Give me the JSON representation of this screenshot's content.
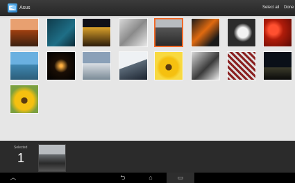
{
  "action_bar": {
    "title": "Asus",
    "select_all": "Select all",
    "done": "Done"
  },
  "gallery": {
    "rows": [
      [
        {
          "name": "tile-dusk-lamp",
          "bg": "linear-gradient(180deg,#e8a070 0 40%, #a04010 41%, #3a2010 100%)"
        },
        {
          "name": "tile-dark-teal",
          "bg": "linear-gradient(135deg,#0f3b4b,#1e6e86 60%, #0c2a36)"
        },
        {
          "name": "tile-night-city",
          "bg": "linear-gradient(180deg,#101018 0 30%, #d9a02a 31%, #2a1a0a 100%)"
        },
        {
          "name": "tile-cat",
          "bg": "linear-gradient(135deg,#d8d8d8,#8a8a8a 50%, #eaeaea)"
        },
        {
          "name": "tile-couple-walk",
          "bg": "linear-gradient(180deg,#b8bcc0 0 30%, #555 31%, #2a2a2a 100%)",
          "selected": true
        },
        {
          "name": "tile-clownfish",
          "bg": "linear-gradient(135deg,#1a1a1a,#e06a10 45%, #1a1a1a 80%)"
        },
        {
          "name": "tile-dandelion",
          "bg": "radial-gradient(circle at 55% 50%, #f2f2f2 0 25%, #2b2b2b 45%)"
        },
        {
          "name": "tile-red-lanterns",
          "bg": "radial-gradient(circle at 35% 40%, #ff5030 0 20%, #b01c0a 40%, #5a0a05 100%)"
        }
      ],
      [
        {
          "name": "tile-coast",
          "bg": "linear-gradient(180deg,#6ab0e0 0 45%, #3f86b0 46%, #2c5e7a 100%)"
        },
        {
          "name": "tile-sky-lanterns",
          "bg": "radial-gradient(circle at 50% 50%, #ffb040 0 6%, #1a0e05 35%, #000 100%)"
        },
        {
          "name": "tile-clouds",
          "bg": "linear-gradient(180deg,#8aa0b8 0 40%, #d8dde3 41%, #7a8a96 100%)"
        },
        {
          "name": "tile-snow-rock",
          "bg": "linear-gradient(160deg,#eef1f4 0 45%, #5b6a78 46%, #1c2430 100%)"
        },
        {
          "name": "tile-sunflower",
          "bg": "radial-gradient(circle at 50% 55%, #5a3a10 0 15%, #f5c010 16% 45%, #f8d940 60%)"
        },
        {
          "name": "tile-flower-bw",
          "bg": "linear-gradient(135deg,#d8d8d8,#3a3a3a 55%, #f0f0f0)"
        },
        {
          "name": "tile-pattern",
          "bg": "repeating-linear-gradient(45deg,#8a2020 0 3px,#e0e0e0 3px 6px)"
        },
        {
          "name": "tile-night-bridge",
          "bg": "linear-gradient(180deg,#0a1018 0 55%, #3a3a2a 56%, #0a0a0a 100%)"
        }
      ],
      [
        {
          "name": "tile-sunflower-2",
          "bg": "radial-gradient(circle at 50% 55%, #5a3a10 0 15%, #f5c010 16% 45%, #7ca040 70%)"
        }
      ]
    ]
  },
  "selection": {
    "label": "Selected",
    "count": "1"
  },
  "navbar": {
    "back": "⮌",
    "home": "⌂",
    "recent": "▭"
  }
}
